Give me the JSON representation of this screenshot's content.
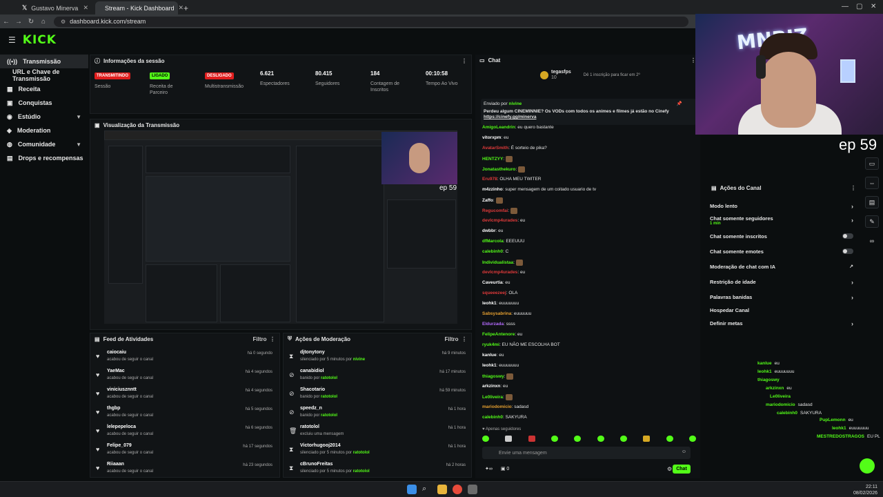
{
  "browser": {
    "tabs": [
      {
        "title": "Gustavo Minerva no X: \"",
        "active": false
      },
      {
        "title": "Stream - Kick Dashboard",
        "active": true
      }
    ],
    "url": "dashboard.kick.com/stream"
  },
  "app": {
    "logo": "KICK"
  },
  "sidebar": {
    "items": [
      {
        "label": "Transmissão",
        "icon": "broadcast-icon"
      },
      {
        "label": "URL e Chave de Transmissão",
        "icon": ""
      },
      {
        "label": "Receita",
        "icon": "revenue-icon"
      },
      {
        "label": "Conquistas",
        "icon": "achievements-icon"
      },
      {
        "label": "Estúdio",
        "icon": "studio-icon"
      },
      {
        "label": "Moderation",
        "icon": "moderation-icon"
      },
      {
        "label": "Comunidade",
        "icon": "community-icon"
      },
      {
        "label": "Drops e recompensas",
        "icon": "drops-icon"
      }
    ]
  },
  "session": {
    "title": "Informações da sessão",
    "stats": [
      {
        "badge": "TRANSMITINDO",
        "badge_color": "#e01e1e",
        "label": "Sessão"
      },
      {
        "badge": "LIGADO",
        "badge_color": "#53fc18",
        "label": "Receita de Parceiro"
      },
      {
        "badge": "DESLIGADO",
        "badge_color": "#e01e1e",
        "label": "Multistransmissão"
      },
      {
        "value": "6.621",
        "label": "Espectadores"
      },
      {
        "value": "80.415",
        "label": "Seguidores"
      },
      {
        "value": "184",
        "label": "Contagem de Inscritos"
      },
      {
        "value": "00:10:58",
        "label": "Tempo Ao Vivo"
      }
    ]
  },
  "preview": {
    "title": "Visualização da Transmissão",
    "overlay_text": "ep 59"
  },
  "activity": {
    "title": "Feed de Atividades",
    "filter": "Filtro",
    "rows": [
      {
        "name": "caiocaiu",
        "text": "acabou de seguir o canal",
        "time": "há 0 segundo"
      },
      {
        "name": "YaeMac",
        "text": "acabou de seguir o canal",
        "time": "há 4 segundos"
      },
      {
        "name": "viniciusznntt",
        "text": "acabou de seguir o canal",
        "time": "há 4 segundos"
      },
      {
        "name": "thgbp",
        "text": "acabou de seguir o canal",
        "time": "há 5 segundos"
      },
      {
        "name": "lelepepeloca",
        "text": "acabou de seguir o canal",
        "time": "há 6 segundos"
      },
      {
        "name": "Felipe_079",
        "text": "acabou de seguir o canal",
        "time": "há 17 segundos"
      },
      {
        "name": "Riiaaan",
        "text": "acabou de seguir o canal",
        "time": "há 23 segundos"
      }
    ]
  },
  "moderation": {
    "title": "Ações de Moderação",
    "filter": "Filtro",
    "rows": [
      {
        "icon": "hourglass-icon",
        "name": "djtonytony",
        "text": "silenciado por 5 minutos por",
        "by": "nivine",
        "time": "há 9 minutos"
      },
      {
        "icon": "ban-icon",
        "name": "canabidiol",
        "text": "banido por",
        "by": "ratotolol",
        "time": "há 17 minutos"
      },
      {
        "icon": "ban-icon",
        "name": "Shacotario",
        "text": "banido por",
        "by": "ratotolol",
        "time": "há 59 minutos"
      },
      {
        "icon": "ban-icon",
        "name": "speedz_n",
        "text": "banido por",
        "by": "ratotolol",
        "time": "há 1 hora"
      },
      {
        "icon": "trash-icon",
        "name": "ratotolol",
        "text": "excluiu uma mensagem",
        "by": "",
        "time": "há 1 hora"
      },
      {
        "icon": "hourglass-icon",
        "name": "Victorhugooj2014",
        "text": "silenciado por 5 minutos por",
        "by": "ratotolol",
        "time": "há 1 hora"
      },
      {
        "icon": "hourglass-icon",
        "name": "cBrunoFreitas",
        "text": "silenciado por 5 minutos por",
        "by": "ratotolol",
        "time": "há 2 horas"
      }
    ]
  },
  "chat": {
    "title": "Chat",
    "top_user": "tegasfps",
    "top_count": "10",
    "top_note": "Dê 1 inscrição para ficar em 2º",
    "pinned_by_label": "Enviado por",
    "pinned_by": "nivine",
    "pinned_text": "Perdeu algum CINEMINNIE? Os VODs com todos os animes e filmes já estão no Cinefy",
    "pinned_link": "https://cinefy.gg/minerva",
    "messages": [
      {
        "user": "AmigoLeandrin",
        "color": "#53fc18",
        "text": "eu quero bastante"
      },
      {
        "user": "vitorxpm",
        "color": "#ffffff",
        "text": "eu"
      },
      {
        "user": "AvatarSmith",
        "color": "#e03a3a",
        "text": "É sorteio de pika?"
      },
      {
        "user": "HENTZYY",
        "color": "#53fc18",
        "text": ""
      },
      {
        "user": "Jonatasthekuro",
        "color": "#53fc18",
        "text": ""
      },
      {
        "user": "Eru978",
        "color": "#e03a3a",
        "text": "OLHA MEU TWITER"
      },
      {
        "user": "m4zzinho",
        "color": "#ffffff",
        "text": "super mensagem de um coitado usuario de tv"
      },
      {
        "user": "Zaffo",
        "color": "#ffffff",
        "text": ""
      },
      {
        "user": "Regucomfai",
        "color": "#e03a3a",
        "text": ""
      },
      {
        "user": "devlcmp4urades",
        "color": "#e03a3a",
        "text": "eu"
      },
      {
        "user": "dwbbr",
        "color": "#ffffff",
        "text": "eu"
      },
      {
        "user": "dfMarcola",
        "color": "#53fc18",
        "text": "EEEUUU"
      },
      {
        "user": "calebinh0",
        "color": "#53fc18",
        "text": "C"
      },
      {
        "user": "Individualistaa",
        "color": "#53fc18",
        "text": ""
      },
      {
        "user": "devlcmp4urades",
        "color": "#e03a3a",
        "text": "eu"
      },
      {
        "user": "Caveurtia",
        "color": "#ffffff",
        "text": "eu"
      },
      {
        "user": "squeeezeej",
        "color": "#e03a3a",
        "text": "OLA"
      },
      {
        "user": "leohk1",
        "color": "#ffffff",
        "text": "euuuuuuu"
      },
      {
        "user": "Sabsysabrina",
        "color": "#e6a030",
        "text": "euuuuuu"
      },
      {
        "user": "Eldurzada",
        "color": "#b56bff",
        "text": "ssss"
      },
      {
        "user": "FelipeAntenore",
        "color": "#53fc18",
        "text": "eu"
      },
      {
        "user": "ryuk4mi",
        "color": "#53fc18",
        "text": "EU NÃO ME ESCOLHA BOT"
      },
      {
        "user": "kanlue",
        "color": "#ffffff",
        "text": "eu"
      },
      {
        "user": "leohk1",
        "color": "#ffffff",
        "text": "euuuuuuu"
      },
      {
        "user": "thiagoswy",
        "color": "#53fc18",
        "text": ""
      },
      {
        "user": "arkzinxn",
        "color": "#ffffff",
        "text": "eu"
      },
      {
        "user": "Le0liveira",
        "color": "#53fc18",
        "text": ""
      },
      {
        "user": "mariodomicio",
        "color": "#e6a030",
        "text": "sadasd"
      },
      {
        "user": "calebinh0",
        "color": "#53fc18",
        "text": "SAKYURA"
      }
    ],
    "followers_only": "Apenas seguidores",
    "input_placeholder": "Envie uma mensagem",
    "points": "0",
    "send_label": "Chat"
  },
  "channel_actions": {
    "title": "Ações do Canal",
    "items": [
      {
        "label": "Modo lento",
        "sub": "",
        "control": "chevron"
      },
      {
        "label": "Chat somente seguidores",
        "sub": "1 min",
        "control": "chevron"
      },
      {
        "label": "Chat somente inscritos",
        "sub": "",
        "control": "toggle"
      },
      {
        "label": "Chat somente emotes",
        "sub": "",
        "control": "toggle"
      },
      {
        "label": "Moderação de chat com IA",
        "sub": "",
        "control": "external"
      },
      {
        "label": "Restrição de idade",
        "sub": "",
        "control": "chevron"
      },
      {
        "label": "Palavras banidas",
        "sub": "",
        "control": "chevron"
      },
      {
        "label": "Hospedar Canal",
        "sub": "",
        "control": ""
      },
      {
        "label": "Definir metas",
        "sub": "",
        "control": "chevron"
      }
    ]
  },
  "overlay": {
    "ep_text": "ep 59",
    "cam_text": "MNBIZ",
    "chat": [
      {
        "user": "kanlue",
        "text": "eu"
      },
      {
        "user": "leohk1",
        "text": "euuuuuuu"
      },
      {
        "user": "thiagoswy",
        "text": ""
      },
      {
        "user": "arkzinxn",
        "text": "eu"
      },
      {
        "user": "Le0liveira",
        "text": ""
      },
      {
        "user": "mariodomicio",
        "text": "sadasd"
      },
      {
        "user": "calebinh0",
        "text": "SAKYURA"
      },
      {
        "user": "PupLemonn",
        "text": "eu"
      },
      {
        "user": "leohk1",
        "text": "euuuuuuu"
      },
      {
        "user": "MESTREDOSTRAGOS",
        "text": "EU PL"
      }
    ]
  },
  "taskbar": {
    "time": "22:11",
    "date": "08/02/2026"
  }
}
